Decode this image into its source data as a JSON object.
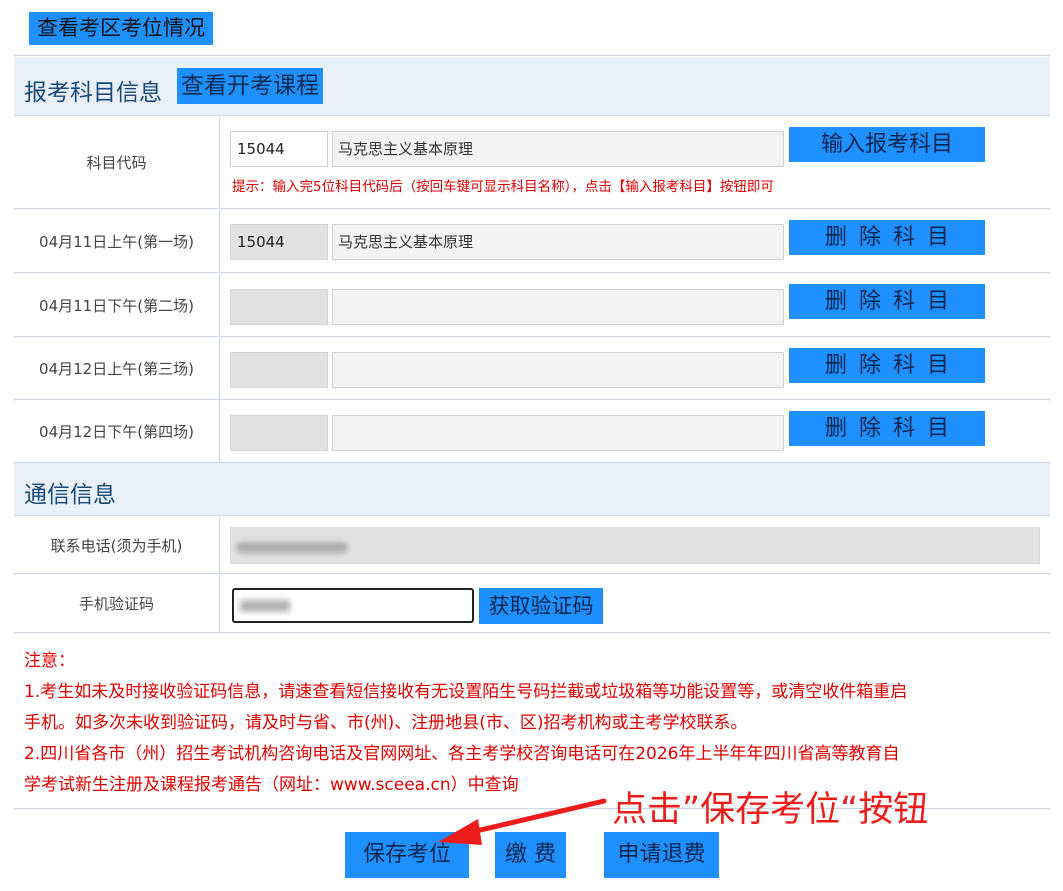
{
  "top": {
    "view_slots_button": "查看考区考位情况"
  },
  "subject_section": {
    "title": "报考科目信息",
    "open_courses_button": "查看开考课程",
    "code_row": {
      "label": "科目代码",
      "code_value": "15044",
      "name_value": "马克思主义基本原理",
      "enter_button": "输入报考科目",
      "hint": "提示：输入完5位科目代码后（按回车键可显示科目名称），点击【输入报考科目】按钮即可"
    },
    "sessions": [
      {
        "label": "04月11日上午(第一场)",
        "code": "15044",
        "name": "马克思主义基本原理",
        "delete_button": "删除科目"
      },
      {
        "label": "04月11日下午(第二场)",
        "code": "",
        "name": "",
        "delete_button": "删除科目"
      },
      {
        "label": "04月12日上午(第三场)",
        "code": "",
        "name": "",
        "delete_button": "删除科目"
      },
      {
        "label": "04月12日下午(第四场)",
        "code": "",
        "name": "",
        "delete_button": "删除科目"
      }
    ]
  },
  "contact_section": {
    "title": "通信信息",
    "phone_label": "联系电话(须为手机)",
    "verify_label": "手机验证码",
    "get_code_button": "获取验证码"
  },
  "notice": {
    "heading": "注意：",
    "line1": "1.考生如未及时接收验证码信息，请速查看短信接收有无设置陌生号码拦截或垃圾箱等功能设置等，或清空收件箱重启",
    "line2": "手机。如多次未收到验证码，请及时与省、市(州)、注册地县(市、区)招考机构或主考学校联系。",
    "line3": "2.四川省各市（州）招生考试机构咨询电话及官网网址、各主考学校咨询电话可在2026年上半年年四川省高等教育自",
    "line4": "学考试新生注册及课程报考通告（网址：www.sceea.cn）中查询"
  },
  "bottom_buttons": {
    "save": "保存考位",
    "pay": "缴 费",
    "refund": "申请退费"
  },
  "annotation": {
    "text": "点击”保存考位“按钮",
    "color": "#ef1c1c"
  },
  "colors": {
    "button_blue": "#1e90ff",
    "section_bg": "#e9f0fa",
    "warning_red": "#e00000"
  }
}
